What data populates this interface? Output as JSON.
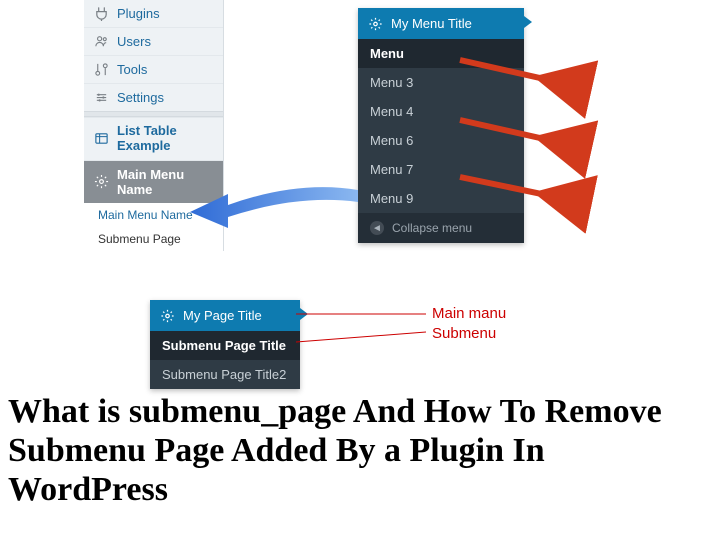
{
  "lightSidebar": {
    "items": [
      {
        "label": "Plugins"
      },
      {
        "label": "Users"
      },
      {
        "label": "Tools"
      },
      {
        "label": "Settings"
      }
    ],
    "listTable": "List Table Example",
    "mainMenuName": "Main Menu Name",
    "sub1": "Main Menu Name",
    "sub2": "Submenu Page"
  },
  "darkMenu1": {
    "title": "My Menu Title",
    "rows": [
      "Menu",
      "Menu 3",
      "Menu 4",
      "Menu 6",
      "Menu 7",
      "Menu 9"
    ],
    "collapse": "Collapse menu"
  },
  "darkMenu2": {
    "title": "My Page Title",
    "rows": [
      "Submenu Page Title",
      "Submenu Page Title2"
    ]
  },
  "redLabels": {
    "main": "Main manu",
    "sub": "Submenu"
  },
  "bigTitle": "What is submenu_page And How To Remove Submenu Page Added By a Plugin In WordPress"
}
